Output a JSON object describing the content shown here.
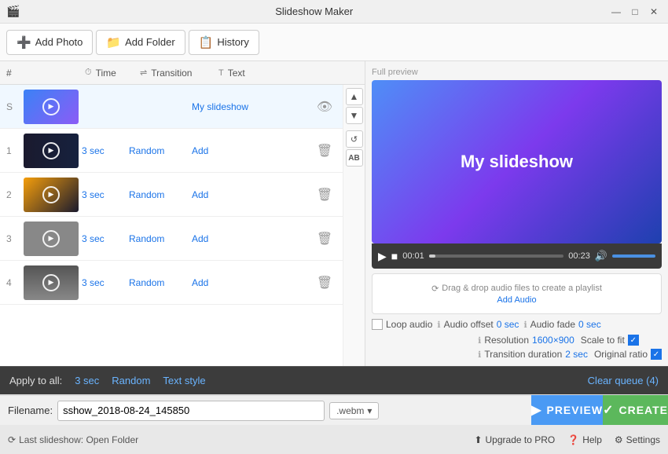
{
  "app": {
    "title": "Slideshow Maker",
    "icon": "🎬"
  },
  "titlebar": {
    "title": "Slideshow Maker",
    "minimize": "—",
    "maximize": "□",
    "close": "✕"
  },
  "toolbar": {
    "add_photo_label": "Add Photo",
    "add_folder_label": "Add Folder",
    "history_label": "History"
  },
  "table_headers": {
    "num": "#",
    "time": "Time",
    "transition": "Transition",
    "text": "Text"
  },
  "slides": [
    {
      "num": "S",
      "time": "",
      "transition": "",
      "text": "My slideshow",
      "action_icon": "👁",
      "thumb_class": "thumb-s",
      "is_title": true
    },
    {
      "num": "1",
      "time": "3 sec",
      "transition": "Random",
      "text": "Add",
      "action_icon": "🗑",
      "thumb_class": "thumb-1",
      "is_title": false
    },
    {
      "num": "2",
      "time": "3 sec",
      "transition": "Random",
      "text": "Add",
      "action_icon": "🗑",
      "thumb_class": "thumb-2",
      "is_title": false
    },
    {
      "num": "3",
      "time": "3 sec",
      "transition": "Random",
      "text": "Add",
      "action_icon": "🗑",
      "thumb_class": "thumb-3",
      "is_title": false
    },
    {
      "num": "4",
      "time": "3 sec",
      "transition": "Random",
      "text": "Add",
      "action_icon": "🗑",
      "thumb_class": "thumb-4",
      "is_title": false
    }
  ],
  "preview": {
    "label": "Full preview",
    "title": "My slideshow",
    "time_current": "00:01",
    "time_total": "00:23"
  },
  "audio": {
    "drag_text": "Drag & drop audio files to create a playlist",
    "add_label": "Add Audio"
  },
  "settings": {
    "loop_audio": "Loop audio",
    "audio_offset": "Audio offset",
    "audio_offset_val": "0 sec",
    "audio_fade": "Audio fade",
    "audio_fade_val": "0 sec",
    "resolution": "Resolution",
    "resolution_val": "1600×900",
    "scale_to_fit": "Scale to fit",
    "transition_duration": "Transition duration",
    "transition_duration_val": "2 sec",
    "original_ratio": "Original ratio"
  },
  "apply_bar": {
    "label": "Apply to all:",
    "time": "3 sec",
    "transition": "Random",
    "text_style": "Text style",
    "clear": "Clear queue (4)"
  },
  "filename_bar": {
    "label": "Filename:",
    "value": "sshow_2018-08-24_145850",
    "ext": ".webm"
  },
  "status_bar": {
    "text": "Last slideshow: Open Folder",
    "upgrade_label": "Upgrade to PRO",
    "help_label": "Help",
    "settings_label": "Settings"
  },
  "action_buttons": {
    "preview_label": "PREVIEW",
    "create_label": "CREATE"
  },
  "colors": {
    "preview_bg_start": "#4f8ef7",
    "preview_bg_end": "#7c3aed",
    "btn_preview": "#4a9af4",
    "btn_create": "#5cb85c",
    "toolbar_bg": "#fafafa",
    "apply_bar_bg": "#3c3c3c",
    "status_bar_bg": "#e8e8e8"
  }
}
